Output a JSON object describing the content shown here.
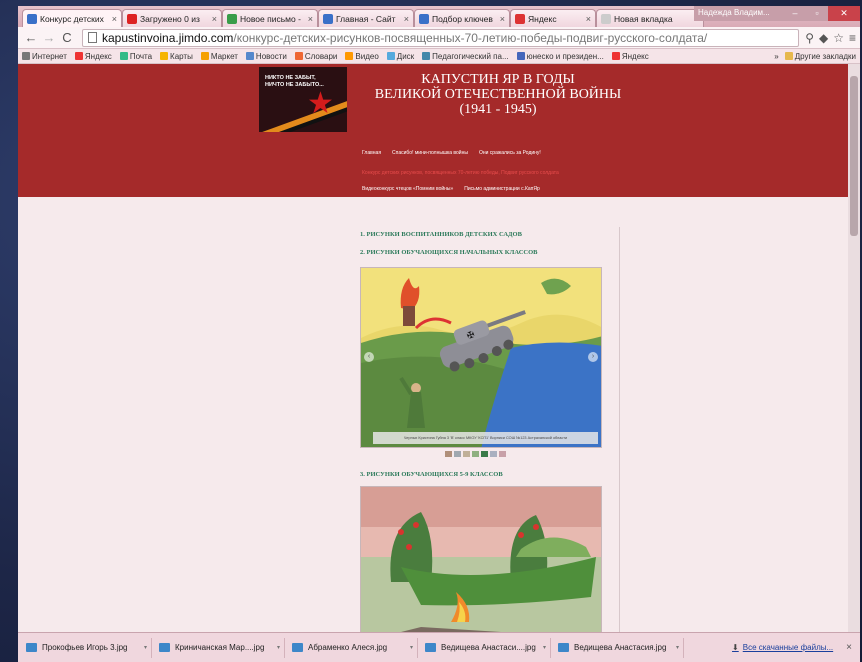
{
  "browser": {
    "tabs": [
      {
        "label": "Конкурс детских",
        "icon_color": "#3a70c8"
      },
      {
        "label": "Загружено 0 из",
        "icon_color": "#d22"
      },
      {
        "label": "Новое письмо -",
        "icon_color": "#3a9d4a"
      },
      {
        "label": "Главная - Сайт",
        "icon_color": "#3a70c8"
      },
      {
        "label": "Подбор ключев",
        "icon_color": "#3a70c8"
      },
      {
        "label": "Яндекс",
        "icon_color": "#d33"
      },
      {
        "label": "Новая вкладка",
        "icon_color": "#ccc"
      }
    ],
    "tab_close": "×",
    "user_name": "Надежда Владим...",
    "url_host": "kapustinvoina.jimdo.com",
    "url_path": "/конкурс-детских-рисунков-посвященных-70-летию-победы-подвиг-русского-солдата/",
    "bookmarks": [
      {
        "label": "Интернет",
        "color": "#777"
      },
      {
        "label": "Яндекс",
        "color": "#e33"
      },
      {
        "label": "Почта",
        "color": "#3b8"
      },
      {
        "label": "Карты",
        "color": "#f5b400"
      },
      {
        "label": "Маркет",
        "color": "#f5a000"
      },
      {
        "label": "Новости",
        "color": "#58c"
      },
      {
        "label": "Словари",
        "color": "#e63"
      },
      {
        "label": "Видео",
        "color": "#f90"
      },
      {
        "label": "Диск",
        "color": "#5ad"
      },
      {
        "label": "Педагогический па...",
        "color": "#48a"
      },
      {
        "label": "юнеско и президен...",
        "color": "#46b"
      },
      {
        "label": "Яндекс",
        "color": "#e33"
      }
    ],
    "bookmarks_more": "»",
    "other_bookmarks": "Другие закладки"
  },
  "site": {
    "logo_text": "НИКТО НЕ ЗАБЫТ,\nНИЧТО НЕ ЗАБЫТО...",
    "title_line1": "КАПУСТИН ЯР В ГОДЫ",
    "title_line2": "ВЕЛИКОЙ ОТЕЧЕСТВЕННОЙ ВОЙНЫ",
    "title_line3": "(1941 - 1945)",
    "menu_row1": [
      "Главная",
      "Спасибо! мини-полнышка войны",
      "Они сражались за Родину!"
    ],
    "menu_row2": "Конкурс детских рисунков, посвященных 70-летию победы, Подвиг русского солдата",
    "menu_row3": [
      "Видеоконкурс чтецов «Помним войны»",
      "Письмо администрации с.КапЯр"
    ],
    "heading1": "1. РИСУНКИ ВОСПИТАННИКОВ ДЕТСКИХ САДОВ",
    "heading2": "2. РИСУНКИ ОБУЧАЮЩИХСЯ НАЧАЛЬНЫХ КЛАССОВ",
    "heading3": "3. РИСУНКИ ОБУЧАЮЩИХСЯ 5-9 КЛАССОВ",
    "caption1": "Черных Кристина Гуйна 3 'В' класс МКОУ 'КСП1' Ворниси СОШ №123 Астраханской области",
    "slider_prev": "‹",
    "slider_next": "›"
  },
  "downloads": {
    "items": [
      "Прокофьев Игорь 3.jpg",
      "Криничанская Мар....jpg",
      "Абраменко Алеся.jpg",
      "Ведищева Анастаси....jpg",
      "Ведищева Анастасия.jpg"
    ],
    "show_all": "Все скачанные файлы...",
    "close": "×"
  }
}
